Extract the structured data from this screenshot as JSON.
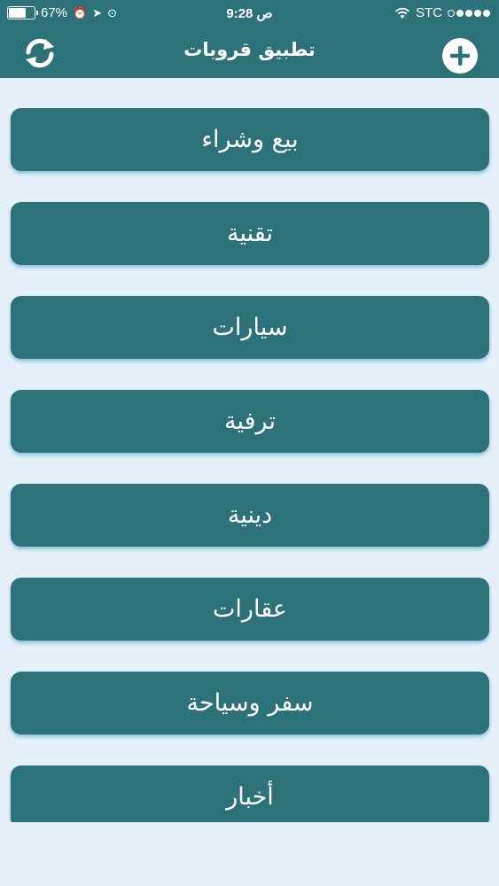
{
  "status_bar": {
    "battery_percent": "67%",
    "battery_level": 0.67,
    "time": "9:28 ص",
    "carrier": "STC",
    "signal_bars": 1
  },
  "header": {
    "title": "تطبيق قروبات",
    "refresh_icon": "refresh-icon",
    "add_icon": "plus-icon"
  },
  "categories": [
    {
      "label": "بيع وشراء"
    },
    {
      "label": "تقنية"
    },
    {
      "label": "سيارات"
    },
    {
      "label": "ترفية"
    },
    {
      "label": "دينية"
    },
    {
      "label": "عقارات"
    },
    {
      "label": "سفر وسياحة"
    },
    {
      "label": "أخبار"
    }
  ],
  "colors": {
    "primary": "#2d7279",
    "background": "#e6f0f8",
    "text_on_primary": "#ffffff"
  }
}
